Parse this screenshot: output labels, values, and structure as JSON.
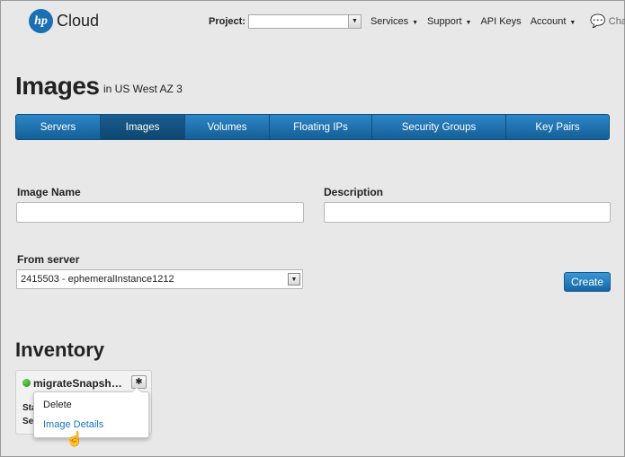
{
  "header": {
    "logo_mark": "hp",
    "logo_text": "Cloud",
    "project_label": "Project:",
    "project_value": "",
    "nav": [
      {
        "label": "Services"
      },
      {
        "label": "Support"
      },
      {
        "label": "API Keys"
      },
      {
        "label": "Account"
      }
    ],
    "chat_label": "Chat"
  },
  "page": {
    "title": "Images",
    "subtitle": "in US West AZ 3"
  },
  "tabs": [
    {
      "label": "Servers"
    },
    {
      "label": "Images"
    },
    {
      "label": "Volumes"
    },
    {
      "label": "Floating IPs"
    },
    {
      "label": "Security Groups"
    },
    {
      "label": "Key Pairs"
    }
  ],
  "form": {
    "image_name_label": "Image Name",
    "image_name_value": "",
    "description_label": "Description",
    "description_value": "",
    "from_server_label": "From server",
    "from_server_value": "2415503 - ephemeralInstance1212",
    "create_label": "Create"
  },
  "inventory": {
    "title": "Inventory",
    "card": {
      "name": "migrateSnapsh…",
      "line1": "Sta",
      "line2": "Ser",
      "status_color": "#2e9a22"
    },
    "menu": [
      {
        "label": "Delete"
      },
      {
        "label": "Image Details"
      }
    ]
  },
  "colors": {
    "accent": "#1b6fb3",
    "link": "#1a73c2"
  }
}
